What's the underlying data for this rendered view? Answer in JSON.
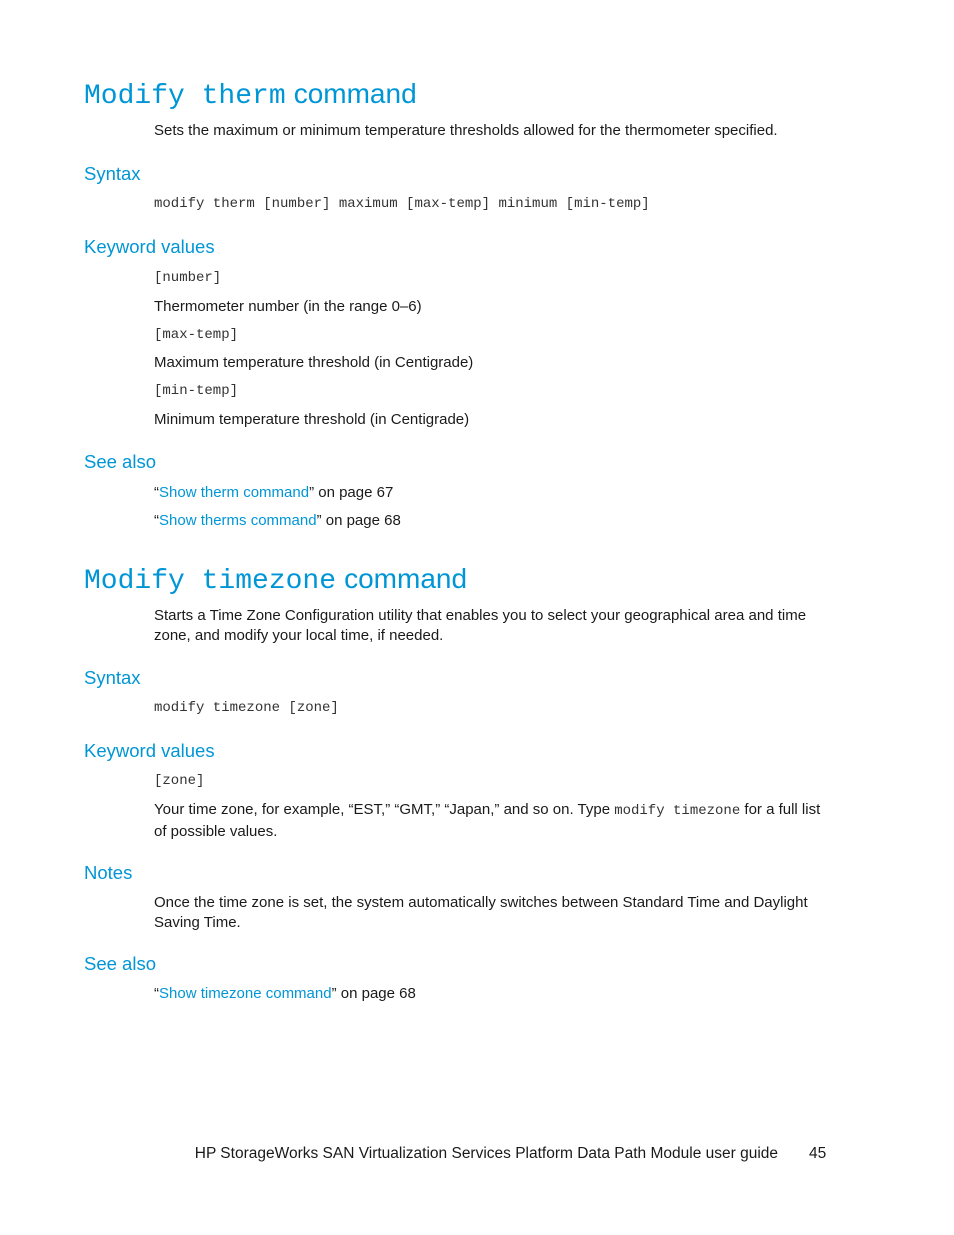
{
  "sections": [
    {
      "title_mono": "Modify therm",
      "title_sans": "command",
      "description": "Sets the maximum or minimum temperature thresholds allowed for the thermometer specified.",
      "syntax_heading": "Syntax",
      "syntax": "modify therm [number] maximum [max-temp] minimum [min-temp]",
      "keyword_heading": "Keyword values",
      "keywords": [
        {
          "name": "[number]",
          "desc": "Thermometer number (in the range 0–6)"
        },
        {
          "name": "[max-temp]",
          "desc": "Maximum temperature threshold (in Centigrade)"
        },
        {
          "name": "[min-temp]",
          "desc": "Minimum temperature threshold (in Centigrade)"
        }
      ],
      "see_also_heading": "See also",
      "see_also": [
        {
          "open_quote": "“",
          "link": "Show therm command",
          "close_quote": "”",
          "suffix": " on page 67"
        },
        {
          "open_quote": "“",
          "link": "Show therms command",
          "close_quote": "”",
          "suffix": " on page 68"
        }
      ]
    },
    {
      "title_mono": "Modify timezone",
      "title_sans": "command",
      "description": "Starts a Time Zone Configuration utility that enables you to select your geographical area and time zone, and modify your local time, if needed.",
      "syntax_heading": "Syntax",
      "syntax": "modify timezone [zone]",
      "keyword_heading": "Keyword values",
      "keywords": [
        {
          "name": "[zone]",
          "desc_before": "Your time zone, for example, “EST,” “GMT,” “Japan,” and so on. Type ",
          "desc_code": "modify timezone",
          "desc_after": " for a full list of possible values."
        }
      ],
      "notes_heading": "Notes",
      "notes": "Once the time zone is set, the system automatically switches between Standard Time and Daylight Saving Time.",
      "see_also_heading": "See also",
      "see_also": [
        {
          "open_quote": "“",
          "link": "Show timezone command",
          "close_quote": "”",
          "suffix": " on page 68"
        }
      ]
    }
  ],
  "footer": {
    "title": "HP StorageWorks SAN Virtualization Services Platform Data Path Module user guide",
    "page_number": "45"
  }
}
